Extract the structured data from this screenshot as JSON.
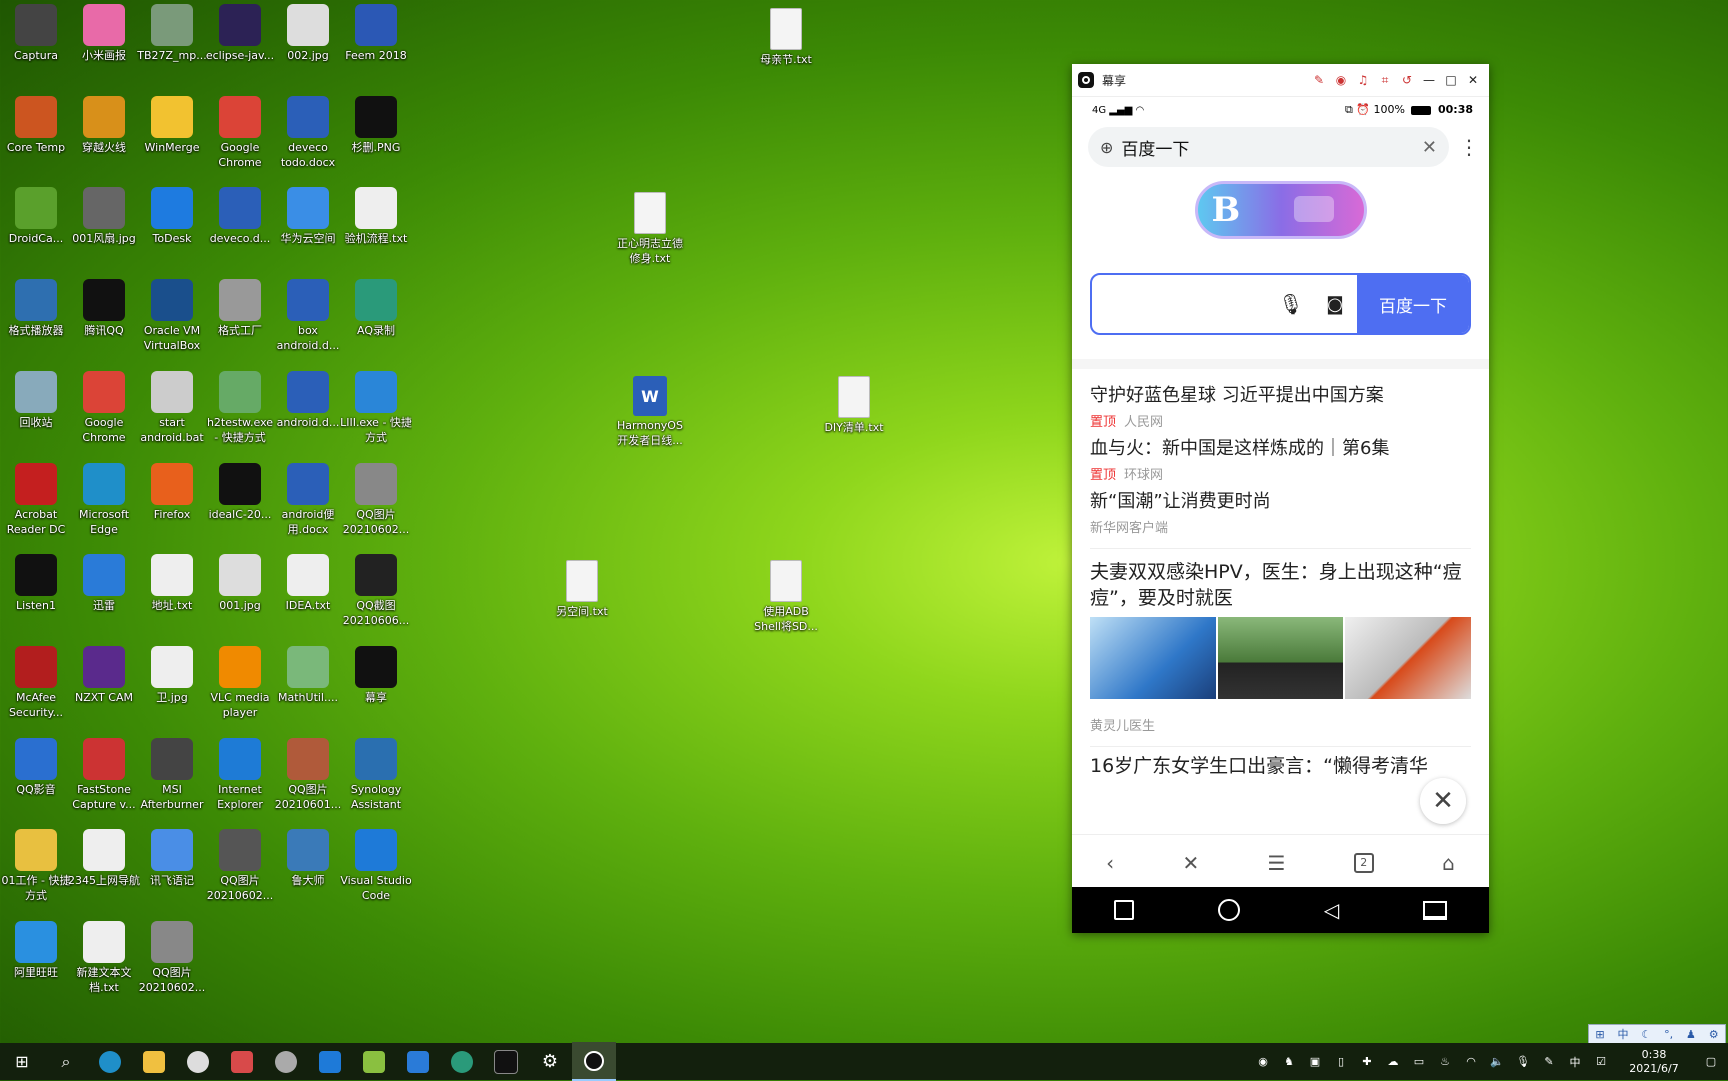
{
  "desktop": {
    "icons": [
      {
        "label": "Captura",
        "color": "#444"
      },
      {
        "label": "小米画报",
        "color": "#e86aa8"
      },
      {
        "label": "TB27Z_mp...",
        "color": "#7a9a7a"
      },
      {
        "label": "eclipse-jav...",
        "color": "#2c2255"
      },
      {
        "label": "002.jpg",
        "color": "#ddd"
      },
      {
        "label": "Feem 2018",
        "color": "#2b58b5"
      },
      {
        "label": "Core Temp",
        "color": "#cc5520"
      },
      {
        "label": "穿越火线",
        "color": "#d8901a"
      },
      {
        "label": "WinMerge",
        "color": "#f2c230"
      },
      {
        "label": "Google Chrome",
        "color": "#db4437"
      },
      {
        "label": "deveco todo.docx",
        "color": "#2b5fb8"
      },
      {
        "label": "杉删.PNG",
        "color": "#111"
      },
      {
        "label": "DroidCa...",
        "color": "#5aa02c"
      },
      {
        "label": "001风扇.jpg",
        "color": "#666"
      },
      {
        "label": "ToDesk",
        "color": "#1e7be0"
      },
      {
        "label": "deveco.d...",
        "color": "#2b5fb8"
      },
      {
        "label": "华为云空间",
        "color": "#3a8ee6"
      },
      {
        "label": "验机流程.txt",
        "color": "#eee"
      },
      {
        "label": "格式播放器",
        "color": "#2e6fb0"
      },
      {
        "label": "腾讯QQ",
        "color": "#111"
      },
      {
        "label": "Oracle VM VirtualBox",
        "color": "#1a4f8c"
      },
      {
        "label": "格式工厂",
        "color": "#999"
      },
      {
        "label": "box android.d...",
        "color": "#2b5fb8"
      },
      {
        "label": "AQ录制",
        "color": "#2a9a7a"
      },
      {
        "label": "回收站",
        "color": "#8ab"
      },
      {
        "label": "Google Chrome",
        "color": "#db4437"
      },
      {
        "label": "start android.bat",
        "color": "#ccc"
      },
      {
        "label": "h2testw.exe - 快捷方式",
        "color": "#6a6"
      },
      {
        "label": "android.d...",
        "color": "#2b5fb8"
      },
      {
        "label": "LIII.exe - 快捷方式",
        "color": "#2a86d8"
      },
      {
        "label": "Acrobat Reader DC",
        "color": "#c41f1f"
      },
      {
        "label": "Microsoft Edge",
        "color": "#1f8fc9"
      },
      {
        "label": "Firefox",
        "color": "#e8601c"
      },
      {
        "label": "idealC-20...",
        "color": "#111"
      },
      {
        "label": "android便用.docx",
        "color": "#2b5fb8"
      },
      {
        "label": "QQ图片 20210602...",
        "color": "#888"
      },
      {
        "label": "Listen1",
        "color": "#111"
      },
      {
        "label": "迅雷",
        "color": "#2a7bd8"
      },
      {
        "label": "地址.txt",
        "color": "#eee"
      },
      {
        "label": "001.jpg",
        "color": "#ddd"
      },
      {
        "label": "IDEA.txt",
        "color": "#eee"
      },
      {
        "label": "QQ截图 20210606...",
        "color": "#222"
      },
      {
        "label": "McAfee Security...",
        "color": "#b21e1e"
      },
      {
        "label": "NZXT CAM",
        "color": "#5a2a8c"
      },
      {
        "label": "卫.jpg",
        "color": "#eee"
      },
      {
        "label": "VLC media player",
        "color": "#f08a00"
      },
      {
        "label": "MathUtil....",
        "color": "#7ab87a"
      },
      {
        "label": "幕享",
        "color": "#111"
      },
      {
        "label": "QQ影音",
        "color": "#2a6fd0"
      },
      {
        "label": "FastStone Capture v...",
        "color": "#c33"
      },
      {
        "label": "MSI Afterburner",
        "color": "#444"
      },
      {
        "label": "Internet Explorer",
        "color": "#1e7bd6"
      },
      {
        "label": "QQ图片 20210601...",
        "color": "#b05a3a"
      },
      {
        "label": "Synology Assistant",
        "color": "#2a6fb0"
      },
      {
        "label": "01工作 - 快捷方式",
        "color": "#e8c040"
      },
      {
        "label": "2345上网导航",
        "color": "#eee"
      },
      {
        "label": "讯飞语记",
        "color": "#4a8ee6"
      },
      {
        "label": "QQ图片 20210602...",
        "color": "#555"
      },
      {
        "label": "鲁大师",
        "color": "#3a7ab8"
      },
      {
        "label": "Visual Studio Code",
        "color": "#1e7ad8"
      },
      {
        "label": "阿里旺旺",
        "color": "#2a90e0"
      },
      {
        "label": "新建文本文档.txt",
        "color": "#eee"
      },
      {
        "label": "QQ图片 20210602...",
        "color": "#888"
      }
    ],
    "loose_icons": [
      {
        "label": "母亲节.txt"
      },
      {
        "label": "正心明志立德修身.txt"
      },
      {
        "label": "HarmonyOS开发者日线..."
      },
      {
        "label": "DIY清单.txt"
      },
      {
        "label": "另空间.txt"
      },
      {
        "label": "使用ADB Shell将SD..."
      }
    ]
  },
  "phone_window": {
    "title": "幕享",
    "status": {
      "network": "4G",
      "battery": "100%",
      "time": "00:38"
    },
    "address": "百度一下",
    "search_button": "百度一下",
    "news": [
      {
        "title": "守护好蓝色星球 习近平提出中国方案",
        "tag": "置顶",
        "source": "人民网"
      },
      {
        "title": "血与火：新中国是这样炼成的｜第6集",
        "tag": "置顶",
        "source": "环球网"
      },
      {
        "title": "新“国潮”让消费更时尚",
        "tag": "",
        "source": "新华网客户端"
      },
      {
        "title": "夫妻双双感染HPV，医生：身上出现这种“痘痘”，要及时就医",
        "tag": "",
        "source": "黄灵儿医生"
      },
      {
        "title": "16岁广东女学生口出豪言：“懒得考清华",
        "tag": "",
        "source": ""
      }
    ],
    "tabs_count": "2"
  },
  "taskbar": {
    "clock_time": "0:38",
    "clock_date": "2021/6/7",
    "ime": "中"
  }
}
